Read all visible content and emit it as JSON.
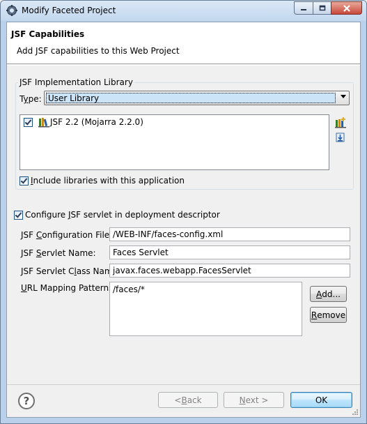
{
  "window": {
    "title": "Modify Faceted Project"
  },
  "banner": {
    "title": "JSF Capabilities",
    "description": "Add JSF capabilities to this Web Project"
  },
  "implementation": {
    "group_label": "JSF Implementation Library",
    "type_label_pre": "T",
    "type_label_mn": "y",
    "type_label_post": "pe:",
    "type_value": "User Library",
    "libraries": [
      {
        "name": "JSF 2.2 (Mojarra 2.2.0)",
        "checked": true
      }
    ],
    "include_label_mn": "I",
    "include_label_post": "nclude libraries with this application",
    "include_checked": true
  },
  "servlet": {
    "configure_label_pre": "Configure ",
    "configure_label_mn": "J",
    "configure_label_post": "SF servlet in deployment descriptor",
    "configure_checked": true,
    "config_file_label_pre": "JSF ",
    "config_file_label_mn": "C",
    "config_file_label_post": "onfiguration File:",
    "config_file_value": "/WEB-INF/faces-config.xml",
    "servlet_name_label_pre": "JSF ",
    "servlet_name_label_mn": "S",
    "servlet_name_label_post": "ervlet Name:",
    "servlet_name_value": "Faces Servlet",
    "servlet_class_label_pre": "JSF Servlet C",
    "servlet_class_label_mn": "l",
    "servlet_class_label_post": "ass Name:",
    "servlet_class_value": "javax.faces.webapp.FacesServlet",
    "url_label_mn": "U",
    "url_label_post": "RL Mapping Patterns:",
    "url_patterns": [
      "/faces/*"
    ],
    "add_label_mn": "A",
    "add_label_post": "dd...",
    "remove_label_mn": "R",
    "remove_label_post": "emove"
  },
  "footer": {
    "help_symbol": "?",
    "back_pre": "< ",
    "back_mn": "B",
    "back_post": "ack",
    "next_mn": "N",
    "next_post": "ext >",
    "ok_label": "OK"
  },
  "icons": {
    "app": "gear-icon",
    "library": "library-icon",
    "add_library": "add-library-icon",
    "download_library": "download-library-icon"
  }
}
